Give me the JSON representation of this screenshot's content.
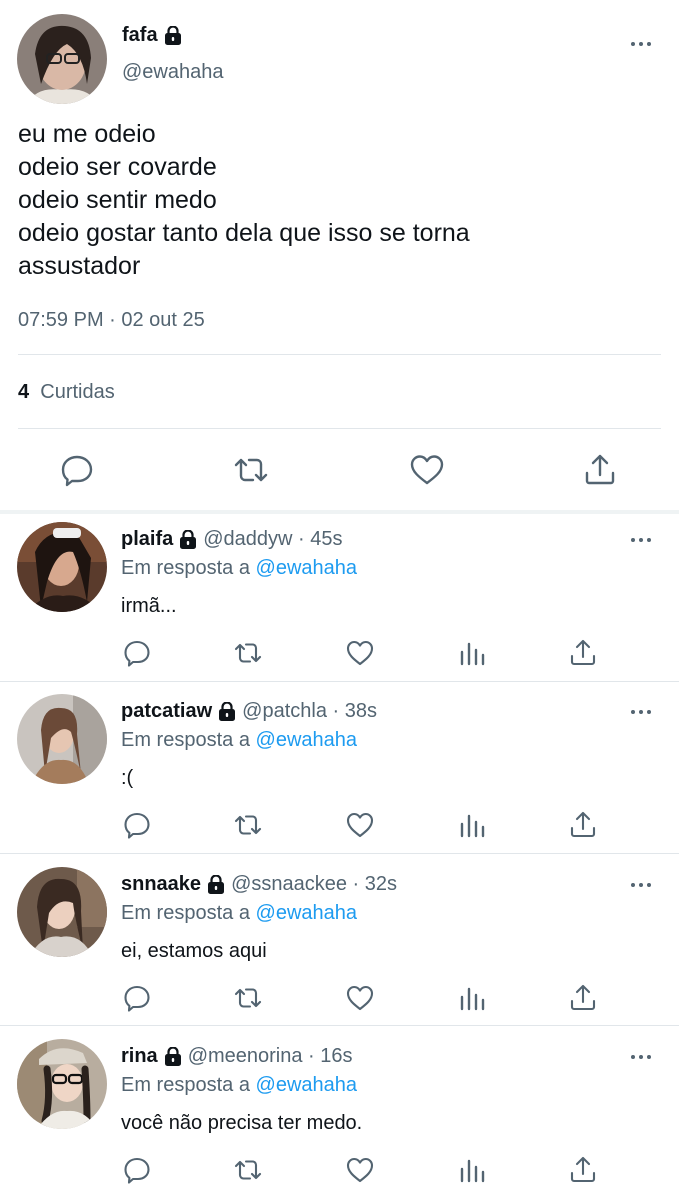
{
  "main_tweet": {
    "name": "fafa",
    "handle": "@ewahaha",
    "text_lines": [
      "eu me odeio",
      "odeio ser covarde",
      "odeio sentir medo",
      "odeio gostar tanto dela que isso se torna",
      "assustador"
    ],
    "timestamp": "07:59 PM · 02 out 25",
    "likes_count": "4",
    "likes_label": "Curtidas"
  },
  "replies": [
    {
      "name": "plaifa",
      "meta": "@daddyw · 45s",
      "reply_prefix": "Em resposta a",
      "reply_to": "@ewahaha",
      "text": "irmã..."
    },
    {
      "name": "patcatiaw",
      "meta": "@patchla · 38s",
      "reply_prefix": "Em resposta a",
      "reply_to": "@ewahaha",
      "text": ":("
    },
    {
      "name": "snnaake",
      "meta": "@ssnaackee · 32s",
      "reply_prefix": "Em resposta a",
      "reply_to": "@ewahaha",
      "text": "ei, estamos aqui"
    },
    {
      "name": "rina",
      "meta": "@meenorina · 16s",
      "reply_prefix": "Em resposta a",
      "reply_to": "@ewahaha",
      "text": "você não precisa ter medo."
    }
  ],
  "colors": {
    "accent": "#1d9bf0",
    "secondary_text": "#536471",
    "primary_text": "#0f1419",
    "divider": "#e1e6ea"
  }
}
